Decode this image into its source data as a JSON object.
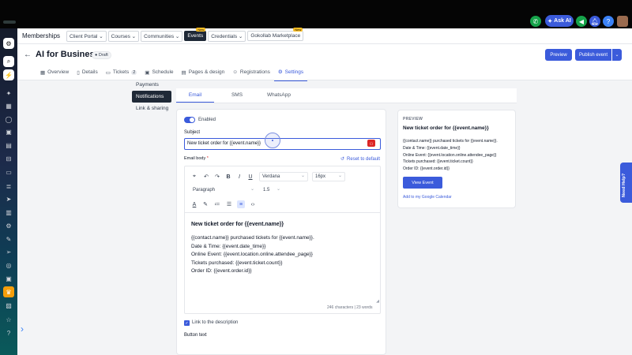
{
  "topbar": {
    "ask_ai_label": "Ask AI",
    "icons": [
      "phone-icon",
      "ask-ai-icon",
      "megaphone-icon",
      "bell-icon",
      "help-icon",
      "user-avatar"
    ],
    "colors": {
      "phone": "#16a34a",
      "accent": "#3b5bdb"
    }
  },
  "sidebar": {
    "icons": [
      "app-logo",
      "search-icon",
      "lightning-icon",
      "sparkle-icon",
      "grid-icon",
      "chat-icon",
      "calendar-icon",
      "contacts-icon",
      "opportunities-icon",
      "payments-icon",
      "email-icon",
      "reporting-icon",
      "settings-icon",
      "send-icon",
      "target-icon",
      "memberships-icon",
      "star-icon",
      "media-icon",
      "help-icon"
    ]
  },
  "nav": {
    "brand": "Memberships",
    "tabs": [
      {
        "label": "Client Portal ⌄"
      },
      {
        "label": "Courses ⌄"
      },
      {
        "label": "Communities ⌄"
      },
      {
        "label": "Events",
        "badge": "New",
        "active": true
      },
      {
        "label": "Credentials ⌄"
      },
      {
        "label": "Gokollab Marketplace",
        "badge": "New"
      }
    ]
  },
  "header": {
    "title": "AI for Business",
    "status": "Draft",
    "preview_button": "Preview",
    "publish_button": "Publish event",
    "tabs": [
      {
        "label": "Overview"
      },
      {
        "label": "Details"
      },
      {
        "label": "Tickets",
        "count": "2"
      },
      {
        "label": "Schedule"
      },
      {
        "label": "Pages & design"
      },
      {
        "label": "Registrations"
      },
      {
        "label": "Settings",
        "active": true
      }
    ]
  },
  "settings_menu": [
    "Payments",
    "Notifications",
    "Link & sharing"
  ],
  "channel_tabs": [
    "Email",
    "SMS",
    "WhatsApp"
  ],
  "email": {
    "enabled_label": "Enabled",
    "subject_label": "Subject",
    "subject_value": "New ticket order for {{event.name}}",
    "body_label": "Email body",
    "reset_label": "Reset to default",
    "toolbar": {
      "font": "Verdana",
      "size": "16px",
      "block": "Paragraph",
      "line_height": "1.5"
    },
    "body": {
      "heading": "New ticket order for {{event.name}}",
      "lines": [
        "{{contact.name}} purchased tickets for {{event.name}}.",
        "Date & Time: {{event.date_time}}",
        "Online Event: {{event.location.online.attendee_page}}",
        "Tickets purchased: {{event.ticket.count}}",
        "Order ID: {{event.order.id}}"
      ]
    },
    "counter": "246 characters | 23 words",
    "link_label": "Link to the description",
    "button_text_label": "Button text"
  },
  "preview": {
    "label": "PREVIEW",
    "title": "New ticket order for {{event.name}}",
    "lines": [
      "{{contact.name}} purchased tickets for {{event.name}}.",
      "Date & Time: {{event.date_time}}",
      "Online Event: {{event.location.online.attendee_page}}",
      "Tickets purchased: {{event.ticket.count}}",
      "Order ID: {{event.order.id}}"
    ],
    "button": "View Event",
    "calendar_link": "Add to my Google Calendar"
  },
  "help_tab": "Need Help?"
}
